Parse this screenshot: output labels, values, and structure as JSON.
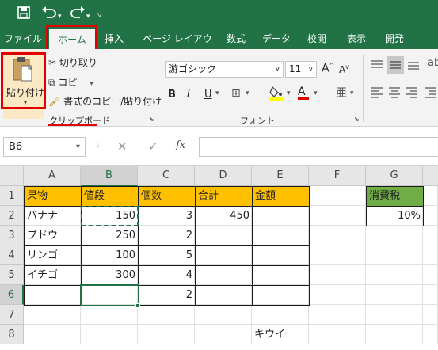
{
  "quick_access": {
    "save": "save",
    "undo": "undo",
    "redo": "redo",
    "customize": "customize"
  },
  "tabs": [
    "ファイル",
    "ホーム",
    "挿入",
    "ページ レイアウト",
    "数式",
    "データ",
    "校閲",
    "表示",
    "開発"
  ],
  "clipboard": {
    "paste_label": "貼り付け",
    "cut_label": "切り取り",
    "copy_label": "コピー",
    "format_painter_label": "書式のコピー/貼り付け",
    "group_label": "クリップボード"
  },
  "font": {
    "font_name": "游ゴシック",
    "font_size": "11",
    "grow_label": "A",
    "shrink_label": "A",
    "bold": "B",
    "italic": "I",
    "underline": "U",
    "font_color": "A",
    "group_label": "フォント"
  },
  "formula_bar": {
    "name_box": "B6",
    "fx_label": "fx",
    "content": ""
  },
  "columns": [
    "A",
    "B",
    "C",
    "D",
    "E",
    "F",
    "G"
  ],
  "rows": [
    "1",
    "2",
    "3",
    "4",
    "5",
    "6",
    "7",
    "8"
  ],
  "cells": {
    "A1": "果物",
    "B1": "値段",
    "C1": "個数",
    "D1": "合計",
    "E1": "金額",
    "G1": "消費税",
    "A2": "バナナ",
    "B2": "150",
    "C2": "3",
    "D2": "450",
    "G2": "10%",
    "A3": "ブドウ",
    "B3": "250",
    "C3": "2",
    "A4": "リンゴ",
    "B4": "100",
    "C4": "5",
    "A5": "イチゴ",
    "B5": "300",
    "C5": "4",
    "C6": "2",
    "E8": "キウイ"
  },
  "colors": {
    "excel_green": "#217346",
    "header_fill": "#ffc000",
    "tax_fill": "#70ad47",
    "highlight_red": "#e00000"
  }
}
